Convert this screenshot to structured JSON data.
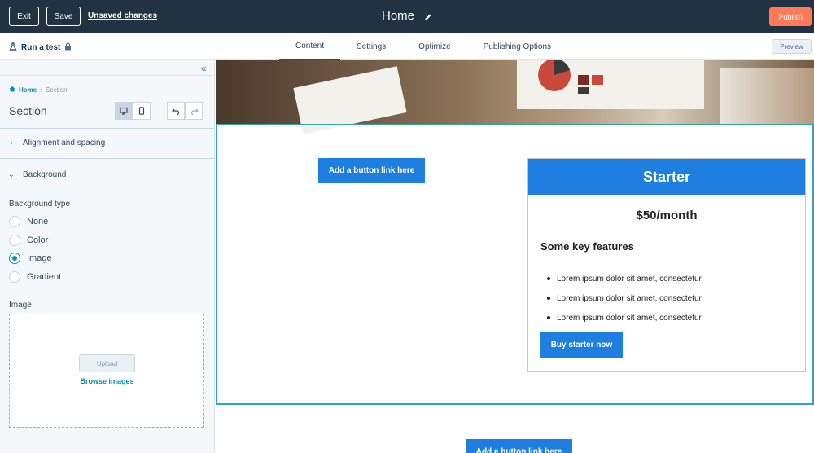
{
  "topbar": {
    "exit_label": "Exit",
    "save_label": "Save",
    "unsaved_label": "Unsaved changes",
    "page_title": "Home",
    "publish_label": "Publish"
  },
  "subbar": {
    "run_test_label": "Run a test",
    "tabs": [
      {
        "label": "Content",
        "active": true
      },
      {
        "label": "Settings"
      },
      {
        "label": "Optimize"
      },
      {
        "label": "Publishing Options"
      }
    ],
    "preview_label": "Preview"
  },
  "sidebar": {
    "breadcrumb": {
      "home": "Home",
      "current": "Section"
    },
    "title": "Section",
    "alignment_label": "Alignment and spacing",
    "background_label": "Background",
    "background_type_label": "Background type",
    "background_options": [
      {
        "label": "None",
        "selected": false
      },
      {
        "label": "Color",
        "selected": false
      },
      {
        "label": "Image",
        "selected": true
      },
      {
        "label": "Gradient",
        "selected": false
      }
    ],
    "image_label": "Image",
    "upload_label": "Upload",
    "browse_label": "Browse images"
  },
  "canvas": {
    "button_label": "Add a button link here",
    "card": {
      "title": "Starter",
      "price": "$50/month",
      "features_title": "Some key features",
      "features": [
        "Lorem ipsum dolor sit amet, consectetur",
        "Lorem ipsum dolor sit amet, consectetur",
        "Lorem ipsum dolor sit amet, consectetur"
      ],
      "cta_label": "Buy starter now"
    },
    "button2_label": "Add a button link here"
  },
  "colors": {
    "topbar": "#213343",
    "publish": "#ff7a59",
    "accent": "#0091ae",
    "button_blue": "#1e7fe0",
    "selection": "#35a3b3"
  }
}
